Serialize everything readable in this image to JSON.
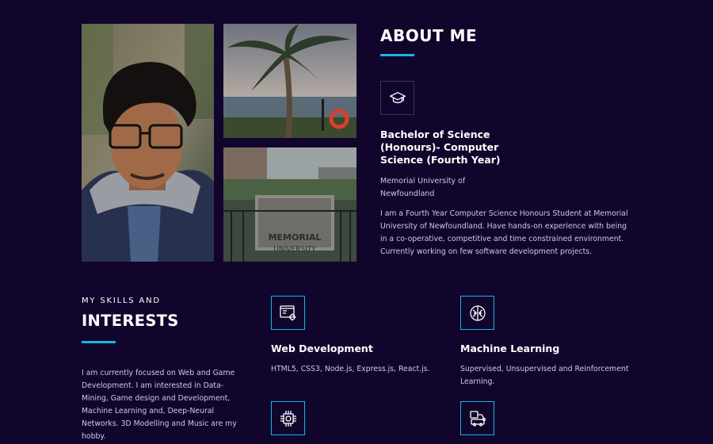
{
  "about": {
    "title": "ABOUT ME",
    "degree_icon": "graduation-cap-icon",
    "degree_line1": "Bachelor of Science",
    "degree_line2": "(Honours)- Computer",
    "degree_line3": "Science (Fourth Year)",
    "university_line1": "Memorial University of",
    "university_line2": "Newfoundland",
    "description": "I am a Fourth Year Computer Science Honours Student at Memorial University of Newfoundland. Have hands-on experience with being in a co-operative, competitive and time constrained environment. Currently working on few software development projects."
  },
  "photos": {
    "campus_sign_line1": "MEMORIAL",
    "campus_sign_line2": "UNIVERSITY"
  },
  "skills": {
    "label_small": "MY SKILLS AND",
    "label_big": "INTERESTS",
    "description": "I am currently focused on Web and Game Development. I am interested in Data-Mining, Game design and Development, Machine Learning and, Deep-Neural Networks. 3D Modelling and Music are my hobby.",
    "items": [
      {
        "icon": "web-development-icon",
        "title": "Web Development",
        "text": "HTML5, CSS3, Node.js, Express.js, React.js."
      },
      {
        "icon": "brain-icon",
        "title": "Machine Learning",
        "text": "Supervised, Unsupervised and Reinforcement Learning."
      },
      {
        "icon": "chip-icon"
      },
      {
        "icon": "robot-arm-icon"
      }
    ]
  },
  "colors": {
    "background": "#11052c",
    "accent": "#17b5e6",
    "heading": "#ffffff",
    "body_text": "#cfc9de"
  }
}
